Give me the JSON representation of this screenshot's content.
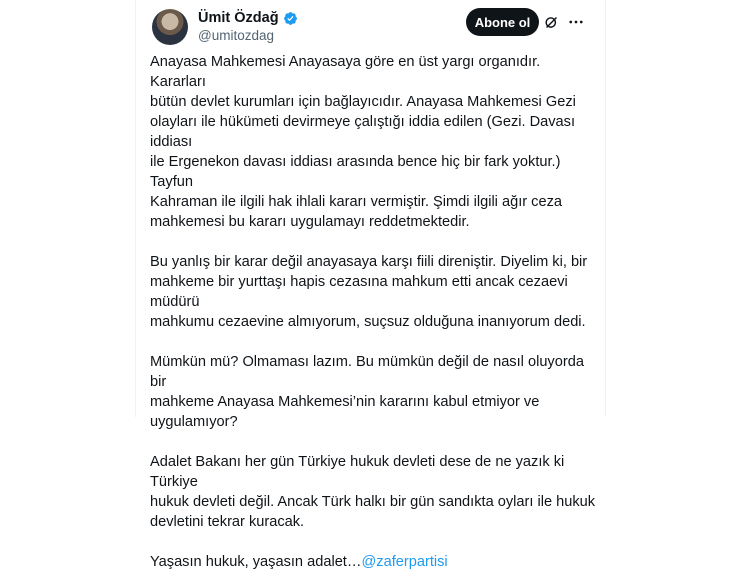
{
  "author": {
    "name": "Ümit Özdağ",
    "handle": "@umitozdag"
  },
  "follow_label": "Abone ol",
  "paragraphs": [
    "Anayasa Mahkemesi Anayasaya göre en üst yargı organıdır. Kararları\nbütün devlet kurumları için bağlayıcıdır. Anayasa Mahkemesi Gezi\nolayları ile hükümeti devirmeye çalıştığı iddia edilen (Gezi. Davası iddiası\nile Ergenekon davası iddiası arasında bence hiç bir fark yoktur.) Tayfun\nKahraman ile ilgili hak ihlali kararı vermiştir. Şimdi ilgili ağır ceza\nmahkemesi bu kararı uygulamayı reddetmektedir.",
    "Bu yanlış bir karar değil anayasaya karşı fiili direniştir.  Diyelim ki, bir\nmahkeme bir yurttaşı hapis cezasına mahkum etti ancak cezaevi müdürü\nmahkumu cezaevine almıyorum, suçsuz olduğuna inanıyorum dedi.",
    "Mümkün mü? Olmaması lazım. Bu mümkün değil de nasıl oluyorda bir\nmahkeme Anayasa Mahkemesi’nin kararını kabul etmiyor ve\nuygulamıyor?",
    "Adalet Bakanı her gün Türkiye hukuk devleti dese de ne yazık ki Türkiye\nhukuk devleti değil. Ancak Türk halkı bir gün sandıkta oyları ile hukuk\ndevletini tekrar kuracak."
  ],
  "closing": {
    "text": "Yaşasın hukuk, yaşasın adalet…",
    "mention": "@zaferpartisi"
  },
  "colors": {
    "accent": "#1d9bf0",
    "text": "#0f1419",
    "muted": "#536471"
  },
  "icons": [
    "verified-badge-icon",
    "grok-icon",
    "more-icon"
  ]
}
